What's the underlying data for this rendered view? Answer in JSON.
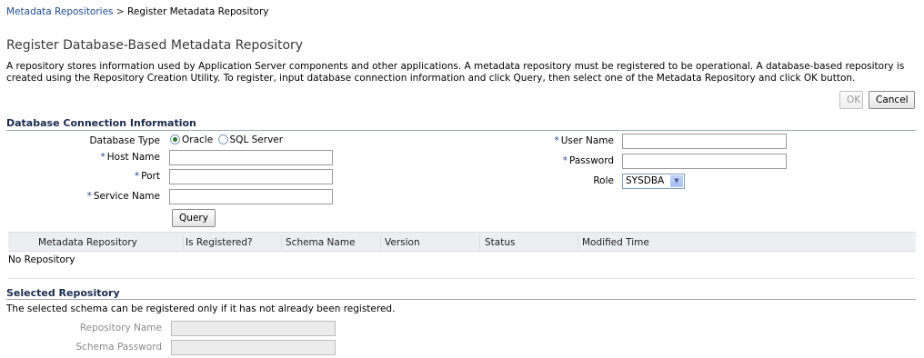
{
  "breadcrumb": {
    "link": "Metadata Repositories",
    "separator": ">",
    "current": "Register Metadata Repository"
  },
  "page": {
    "title": "Register Database-Based Metadata Repository",
    "description": "A repository stores information used by Application Server components and other applications. A metadata repository must be registered to be operational. A database-based repository is created using the Repository Creation Utility. To register, input database connection information and click Query, then select one of the Metadata Repository and click OK button."
  },
  "actions": {
    "ok": "OK",
    "cancel": "Cancel"
  },
  "connection": {
    "section_title": "Database Connection Information",
    "db_type_label": "Database Type",
    "db_type_options": [
      "Oracle",
      "SQL Server"
    ],
    "db_type_selected": "Oracle",
    "host_label": "Host Name",
    "port_label": "Port",
    "service_label": "Service Name",
    "user_label": "User Name",
    "password_label": "Password",
    "role_label": "Role",
    "role_value": "SYSDBA",
    "required_marker": "*",
    "host_value": "",
    "port_value": "",
    "service_value": "",
    "user_value": "",
    "password_value": "",
    "query_button": "Query"
  },
  "table": {
    "columns": [
      "Metadata Repository",
      "Is Registered?",
      "Schema Name",
      "Version",
      "Status",
      "Modified Time"
    ],
    "empty_text": "No Repository"
  },
  "selected": {
    "section_title": "Selected Repository",
    "note": "The selected schema can be registered only if it has not already been registered.",
    "repo_name_label": "Repository Name",
    "schema_password_label": "Schema Password",
    "repo_name_value": "",
    "schema_password_value": ""
  }
}
